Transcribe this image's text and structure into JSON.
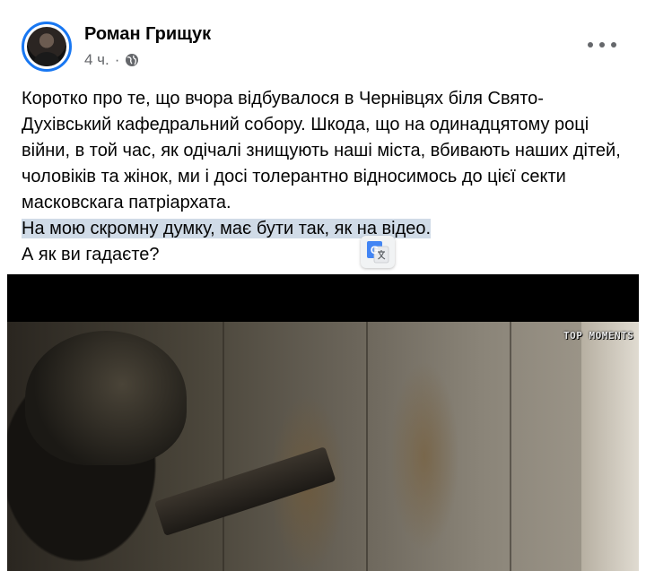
{
  "post": {
    "author": "Роман Грищук",
    "time": "4 ч.",
    "separator": "·",
    "paragraphs": [
      "Коротко про те, що вчора відбувалося в Чернівцях біля Свято-Духівський кафедральний собору. Шкода, що на одинадцятому році війни, в той час, як одічалі знищують наші міста, вбивають наших дітей, чоловіків та жінок, ми і досі толерантно відносимось до цієї секти масковскага патріархата."
    ],
    "highlighted_line": "На мою скромну думку, має бути так, як на відео.",
    "last_line": "А як ви гадаєте?",
    "video_watermark": "TOP MOMENTS"
  },
  "icons": {
    "globe": "globe-icon",
    "more": "more-options-icon",
    "translate": "google-translate-icon"
  },
  "colors": {
    "accent": "#1877f2",
    "secondary_text": "#65676b",
    "highlight": "#d0dbe7"
  }
}
